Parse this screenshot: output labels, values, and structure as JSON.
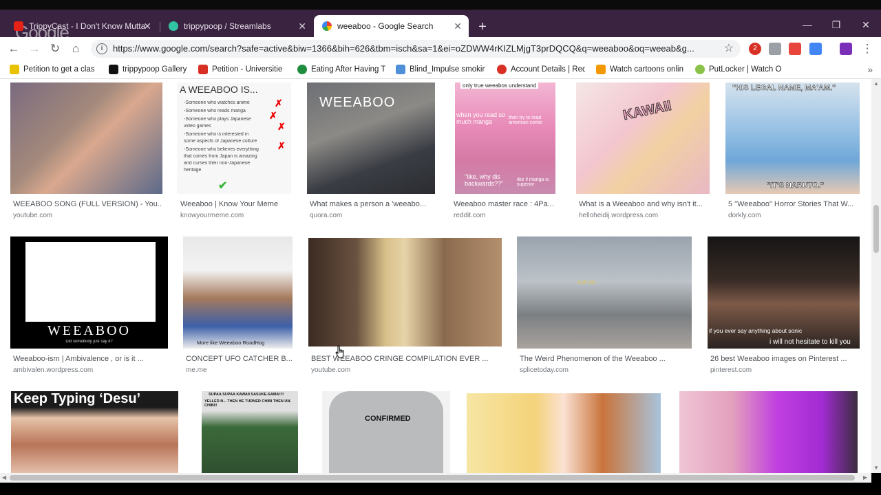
{
  "browser": {
    "tabs": [
      {
        "title": "TrippyCast - I Don't Know Mutta",
        "active": false
      },
      {
        "title": "trippypoop / Streamlabs",
        "active": false
      },
      {
        "title": "weeaboo - Google Search",
        "active": true
      }
    ],
    "new_tab_label": "+",
    "ghost_logo": "Google",
    "window_controls": {
      "minimize": "—",
      "restore": "❐",
      "close": "✕"
    },
    "tab_close": "✕",
    "url": "https://www.google.com/search?safe=active&biw=1366&bih=626&tbm=isch&sa=1&ei=oZDWW4rKIZLMjgT3prDQCQ&q=weeaboo&oq=weeab&g...",
    "extension_badge": "2",
    "bookmarks": [
      {
        "label": "Petition to get a clas",
        "color": "#e8c200"
      },
      {
        "label": "trippypoop Gallery",
        "color": "#111111"
      },
      {
        "label": "Petition - Universitie",
        "color": "#d93025"
      },
      {
        "label": "Eating After Having T",
        "color": "#1e8e3e"
      },
      {
        "label": "Blind_Impulse smokin",
        "color": "#4f8fd8"
      },
      {
        "label": "Account Details | Red",
        "color": "#d93025"
      },
      {
        "label": "Watch cartoons onlin",
        "color": "#f29900"
      },
      {
        "label": "PutLocker | Watch O",
        "color": "#8bc34a"
      }
    ],
    "bookmarks_more": "»"
  },
  "results": {
    "row1": [
      {
        "caption": "WEEABOO SONG (FULL VERSION) - You...",
        "source": "youtube.com"
      },
      {
        "caption": "Weeaboo | Know Your Meme",
        "source": "knowyourmeme.com",
        "overlay_title": "A WEEABOO IS...",
        "overlay_lines": [
          "-Someone who watches anime",
          "-Someone who reads manga",
          "-Someone who plays Japanese",
          "video games",
          "-Someone who is interested in",
          "some aspects of Japanese culture",
          "-Someone who believes everything",
          "that comes from Japan is amazing",
          "and curses their non-Japanese",
          "heritage"
        ]
      },
      {
        "caption": "What makes a person a 'weeabo...",
        "source": "quora.com",
        "overlay": "WEEABOO"
      },
      {
        "caption": "Weeaboo master race : 4Pa...",
        "source": "reddit.com",
        "overlay_top": "only true weeabos understand",
        "overlay_a": "when you read so much manga",
        "overlay_b": "then try to read american comic",
        "overlay_c": "\"like, why dis backwards??\"",
        "overlay_d": "like if manga is superior"
      },
      {
        "caption": "What is a Weeaboo and why isn't it...",
        "source": "helloheidij.wordpress.com",
        "overlay": "KAWAII"
      },
      {
        "caption": "5 \"Weeaboo\" Horror Stories That W...",
        "source": "dorkly.com",
        "overlay_top": "\"HIS LEGAL NAME, MA'AM.\"",
        "overlay_bottom": "\"IT'S NARUTO.\""
      }
    ],
    "row2": [
      {
        "caption": "Weeaboo-ism | Ambivalence , or is it ...",
        "source": "ambivalen.wordpress.com",
        "overlay": "WEEABOO",
        "overlay_sub": "Did somebody just say it?"
      },
      {
        "caption": "CONCEPT UFO CATCHER B...",
        "source": "me.me",
        "overlay": "More like Weeaboo RoadHog"
      },
      {
        "caption": "BEST WEEABOO CRINGE COMPILATION EVER ...",
        "source": "youtube.com"
      },
      {
        "caption": "The Weird Phenomenon of the Weeaboo ...",
        "source": "splicetoday.com",
        "overlay": "SUP SO"
      },
      {
        "caption": "26 best Weeaboo images on Pinterest ...",
        "source": "pinterest.com",
        "overlay_a": "if you ever say anything about sonic",
        "overlay_b": "i will not hesitate to kill you"
      }
    ],
    "row3": [
      {
        "overlay": "Keep Typing ‘Desu’"
      },
      {
        "overlay_a": "SUPAA SUPAA KAWAII SASUKE-SAMA!!!!",
        "overlay_b": "YELLED N... THEN HE TURNED CHIBI THEN UN-CHIBI!!"
      },
      {
        "overlay": "CONFIRMED"
      },
      {},
      {}
    ]
  }
}
